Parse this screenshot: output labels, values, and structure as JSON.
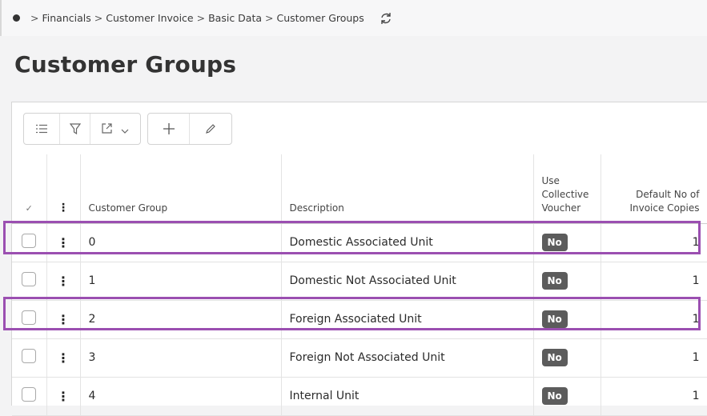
{
  "breadcrumb": [
    "Financials",
    "Customer Invoice",
    "Basic Data",
    "Customer Groups"
  ],
  "page_title": "Customer Groups",
  "toolbar": {
    "icons": [
      "list-icon",
      "filter-icon",
      "export-icon",
      "chevron-down-icon",
      "add-icon",
      "edit-icon"
    ]
  },
  "table": {
    "headers": {
      "customer_group": "Customer Group",
      "description": "Description",
      "collective_voucher": "Use Collective Voucher",
      "invoice_copies": "Default No of Invoice Copies"
    },
    "rows": [
      {
        "group": "0",
        "description": "Domestic Associated Unit",
        "voucher": "No",
        "copies": "1",
        "highlighted": true
      },
      {
        "group": "1",
        "description": "Domestic Not Associated Unit",
        "voucher": "No",
        "copies": "1",
        "highlighted": false
      },
      {
        "group": "2",
        "description": "Foreign Associated Unit",
        "voucher": "No",
        "copies": "1",
        "highlighted": true
      },
      {
        "group": "3",
        "description": "Foreign Not Associated Unit",
        "voucher": "No",
        "copies": "1",
        "highlighted": false
      },
      {
        "group": "4",
        "description": "Internal Unit",
        "voucher": "No",
        "copies": "1",
        "highlighted": false
      }
    ]
  },
  "colors": {
    "highlight": "#9b4fb1",
    "pill": "#5c5c5c"
  }
}
